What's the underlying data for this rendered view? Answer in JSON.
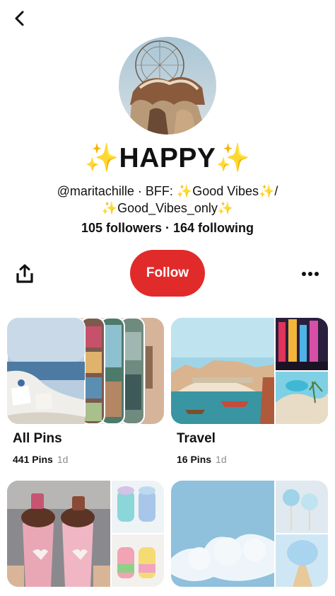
{
  "header": {
    "back_icon": "chevron-left-icon"
  },
  "profile": {
    "name": "✨HAPPY✨",
    "bio_line1": "@maritachille · BFF: ✨Good Vibes✨/",
    "bio_line2": "✨Good_Vibes_only✨",
    "stats": "105 followers · 164 following"
  },
  "actions": {
    "share_icon": "share-icon",
    "follow_label": "Follow",
    "more_icon": "more-horizontal-icon",
    "accent_color": "#e12b2b"
  },
  "boards": [
    {
      "title": "All Pins",
      "pins": "441 Pins",
      "age": "1d"
    },
    {
      "title": "Travel",
      "pins": "16 Pins",
      "age": "1d"
    },
    {
      "title": "",
      "pins": "",
      "age": ""
    },
    {
      "title": "",
      "pins": "",
      "age": ""
    }
  ]
}
